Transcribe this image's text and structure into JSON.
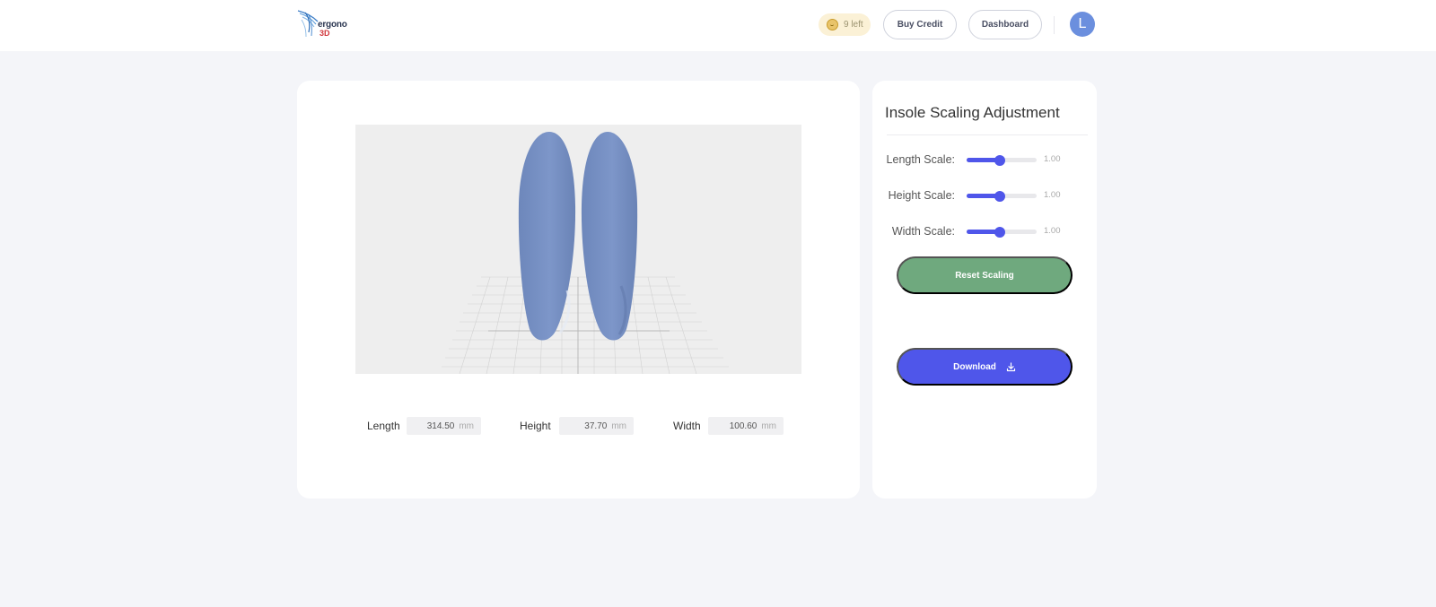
{
  "header": {
    "logo": {
      "word": "ergono",
      "sub": "3D"
    },
    "credits": {
      "text": "9 left",
      "icon": "coin-icon"
    },
    "buy_credit_label": "Buy Credit",
    "dashboard_label": "Dashboard",
    "avatar_initial": "L"
  },
  "viewer": {
    "model": "insole-pair",
    "insole_color": "#7a93c6",
    "background_color": "#eeeeee"
  },
  "dimensions": [
    {
      "label": "Length",
      "value": "314.50",
      "unit": "mm"
    },
    {
      "label": "Height",
      "value": "37.70",
      "unit": "mm"
    },
    {
      "label": "Width",
      "value": "100.60",
      "unit": "mm"
    }
  ],
  "panel": {
    "title": "Insole Scaling Adjustment",
    "sliders": [
      {
        "label": "Length Scale:",
        "value": "1.00",
        "fraction": 0.48
      },
      {
        "label": "Height Scale:",
        "value": "1.00",
        "fraction": 0.48
      },
      {
        "label": "Width Scale:",
        "value": "1.00",
        "fraction": 0.48
      }
    ],
    "reset_label": "Reset Scaling",
    "download_label": "Download"
  },
  "colors": {
    "accent": "#4f56ea",
    "reset_green": "#6fa97e",
    "avatar": "#6b8fde",
    "credit_pill": "#fbf1d6"
  }
}
